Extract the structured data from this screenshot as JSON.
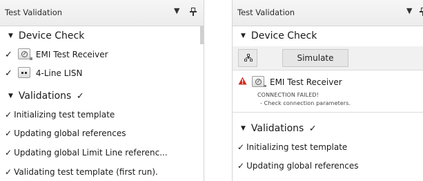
{
  "left": {
    "title": "Test Validation",
    "dropdown_glyph": "▼",
    "device_check": {
      "label": "Device Check",
      "devices": [
        {
          "label": "EMI Test Receiver",
          "icon": "receiver-icon"
        },
        {
          "label": "4-Line LISN",
          "icon": "lisn-icon"
        }
      ]
    },
    "validations": {
      "label": "Validations",
      "items": [
        "Initializing test template",
        "Updating global references",
        "Updating global Limit Line referenc...",
        "Validating test template (first run)."
      ]
    }
  },
  "right": {
    "title": "Test Validation",
    "dropdown_glyph": "▼",
    "device_check": {
      "label": "Device Check",
      "toolbar": {
        "simulate_label": "Simulate"
      },
      "error": {
        "device_label": "EMI Test Receiver",
        "line1": "CONNECTION FAILED!",
        "line2": "- Check connection parameters."
      }
    },
    "validations": {
      "label": "Validations",
      "items": [
        "Initializing test template",
        "Updating global references"
      ]
    }
  },
  "colors": {
    "warning": "#d12a1a",
    "check": "#1a1a1a",
    "titlebar": "#efefef",
    "toolbar": "#f1f1f1"
  },
  "glyphs": {
    "check": "✓",
    "collapse": "▼"
  }
}
